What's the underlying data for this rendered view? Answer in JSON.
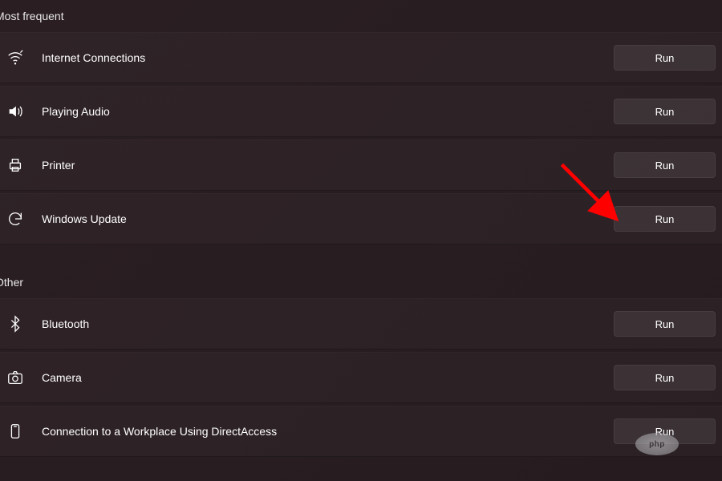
{
  "sections": {
    "most_frequent": {
      "title": "Most frequent"
    },
    "other": {
      "title": "Other"
    }
  },
  "buttons": {
    "run": "Run"
  },
  "rows": {
    "internet": {
      "label": "Internet Connections"
    },
    "audio": {
      "label": "Playing Audio"
    },
    "printer": {
      "label": "Printer"
    },
    "update": {
      "label": "Windows Update"
    },
    "bluetooth": {
      "label": "Bluetooth"
    },
    "camera": {
      "label": "Camera"
    },
    "direct": {
      "label": "Connection to a Workplace Using DirectAccess"
    }
  },
  "watermark": {
    "text": "php"
  },
  "colors": {
    "background": "#291d21",
    "button_bg": "rgba(255,255,255,0.08)",
    "arrow": "#ff0000"
  }
}
